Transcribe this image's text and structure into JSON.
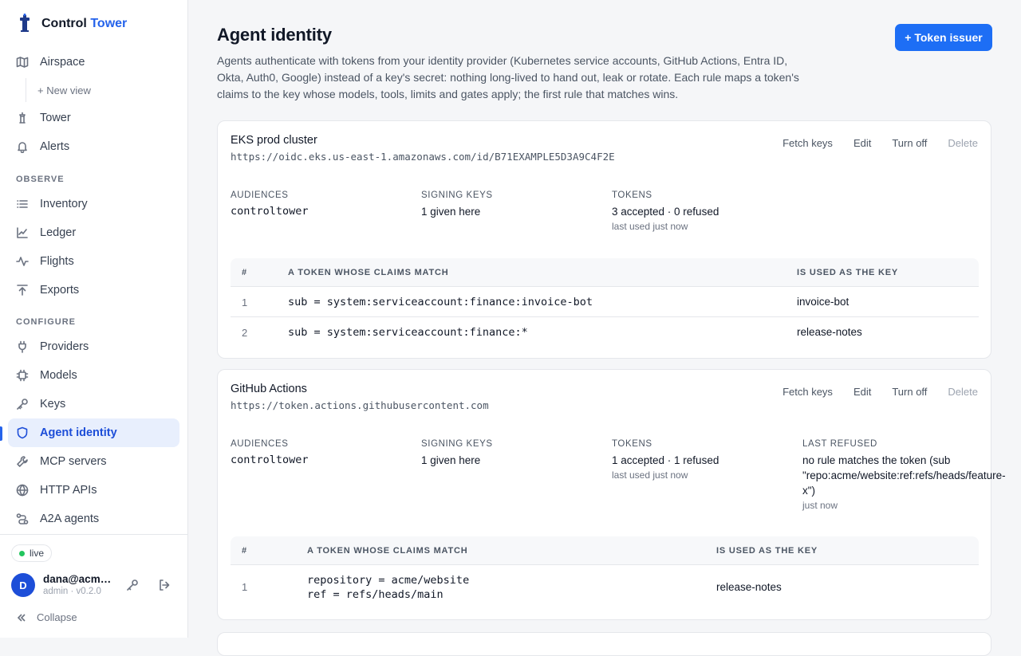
{
  "brand": {
    "name_a": "Control",
    "name_b": "Tower",
    "accent": "#2563eb"
  },
  "nav": {
    "airspace": "Airspace",
    "new_view": "+ New view",
    "tower": "Tower",
    "alerts": "Alerts",
    "observe_label": "OBSERVE",
    "inventory": "Inventory",
    "ledger": "Ledger",
    "flights": "Flights",
    "exports": "Exports",
    "configure_label": "CONFIGURE",
    "providers": "Providers",
    "models": "Models",
    "keys": "Keys",
    "agent_identity": "Agent identity",
    "mcp_servers": "MCP servers",
    "http_apis": "HTTP APIs",
    "a2a_agents": "A2A agents"
  },
  "footer": {
    "status": "live",
    "avatar_initial": "D",
    "user": "dana@acme.com",
    "role": "admin · v0.2.0",
    "collapse": "Collapse"
  },
  "page": {
    "title": "Agent identity",
    "description": "Agents authenticate with tokens from your identity provider (Kubernetes service accounts, GitHub Actions, Entra ID, Okta, Auth0, Google) instead of a key's secret: nothing long-lived to hand out, leak or rotate. Each rule maps a token's claims to the key whose models, tools, limits and gates apply; the first rule that matches wins.",
    "add_button": "+ Token issuer"
  },
  "actions": {
    "fetch": "Fetch keys",
    "edit": "Edit",
    "turn_off": "Turn off",
    "delete": "Delete"
  },
  "labels": {
    "audiences": "AUDIENCES",
    "signing_keys": "SIGNING KEYS",
    "tokens": "TOKENS",
    "last_refused": "LAST REFUSED",
    "col_num": "#",
    "col_claims": "A TOKEN WHOSE CLAIMS MATCH",
    "col_key": "IS USED AS THE KEY"
  },
  "issuers": [
    {
      "name": "EKS prod cluster",
      "url": "https://oidc.eks.us-east-1.amazonaws.com/id/B71EXAMPLE5D3A9C4F2E",
      "audiences": "controltower",
      "signing_keys": "1 given here",
      "tokens": "3 accepted · 0 refused",
      "last_used": "last used just now",
      "rules": [
        {
          "n": "1",
          "claims": [
            "sub = system:serviceaccount:finance:invoice-bot"
          ],
          "key": "invoice-bot"
        },
        {
          "n": "2",
          "claims": [
            "sub = system:serviceaccount:finance:*"
          ],
          "key": "release-notes"
        }
      ]
    },
    {
      "name": "GitHub Actions",
      "url": "https://token.actions.githubusercontent.com",
      "audiences": "controltower",
      "signing_keys": "1 given here",
      "tokens": "1 accepted · 1 refused",
      "last_used": "last used just now",
      "last_refused_l1": "no rule matches the token (sub",
      "last_refused_l2": "\"repo:acme/website:ref:refs/heads/feature-",
      "last_refused_l3": "x\")",
      "last_refused_when": "just now",
      "rules": [
        {
          "n": "1",
          "claims": [
            "repository = acme/website",
            "ref = refs/heads/main"
          ],
          "key": "release-notes"
        }
      ]
    }
  ]
}
